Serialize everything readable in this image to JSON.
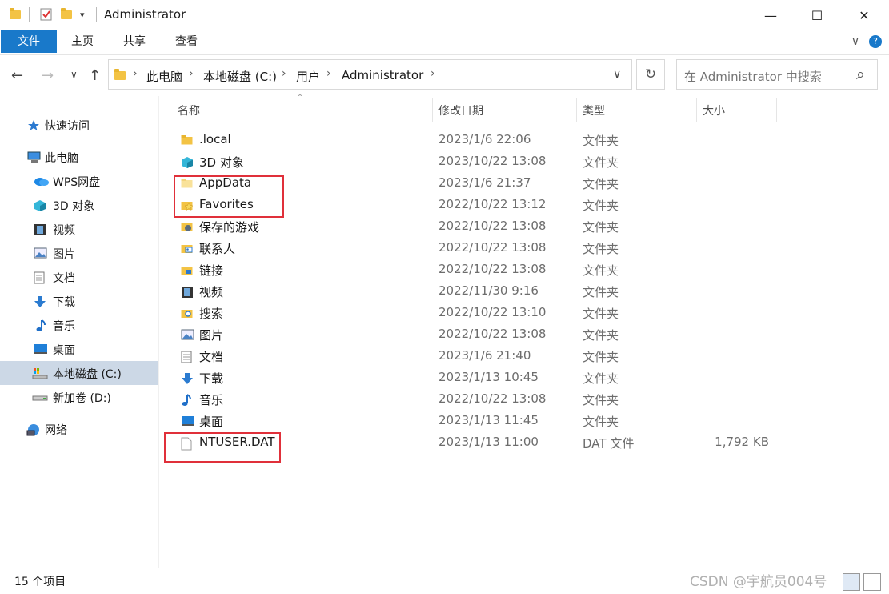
{
  "window": {
    "title": "Administrator",
    "minimize": "—",
    "maximize": "☐",
    "close": "✕"
  },
  "ribbon": {
    "tabs": [
      "文件",
      "主页",
      "共享",
      "查看"
    ],
    "expand_icon": "∨",
    "help_icon": "?"
  },
  "address": {
    "crumbs": [
      "此电脑",
      "本地磁盘 (C:)",
      "用户",
      "Administrator"
    ],
    "separator": "›",
    "dropdown": "∨",
    "refresh": "↻"
  },
  "search": {
    "placeholder": "在 Administrator 中搜索",
    "icon": "⌕"
  },
  "nav_glyphs": {
    "back": "←",
    "forward": "→",
    "recent": "∨",
    "up": "↑",
    "sort": "˄"
  },
  "sidebar": {
    "items": [
      {
        "label": "快速访问",
        "icon": "star-icon"
      },
      {
        "label": "此电脑",
        "icon": "computer-icon"
      },
      {
        "label": "WPS网盘",
        "icon": "cloud-icon"
      },
      {
        "label": "3D 对象",
        "icon": "cube-icon"
      },
      {
        "label": "视频",
        "icon": "video-icon"
      },
      {
        "label": "图片",
        "icon": "picture-icon"
      },
      {
        "label": "文档",
        "icon": "document-icon"
      },
      {
        "label": "下载",
        "icon": "download-icon"
      },
      {
        "label": "音乐",
        "icon": "music-icon"
      },
      {
        "label": "桌面",
        "icon": "desktop-icon"
      },
      {
        "label": "本地磁盘 (C:)",
        "icon": "drive-c-icon",
        "selected": true
      },
      {
        "label": "新加卷 (D:)",
        "icon": "drive-icon"
      },
      {
        "label": "网络",
        "icon": "network-icon"
      }
    ]
  },
  "columns": [
    "名称",
    "修改日期",
    "类型",
    "大小"
  ],
  "files": [
    {
      "name": ".local",
      "date": "2023/1/6 22:06",
      "type": "文件夹",
      "size": "",
      "icon": "folder-icon"
    },
    {
      "name": "3D 对象",
      "date": "2023/10/22 13:08",
      "type": "文件夹",
      "size": "",
      "icon": "cube-icon"
    },
    {
      "name": "AppData",
      "date": "2023/1/6 21:37",
      "type": "文件夹",
      "size": "",
      "icon": "folder-light-icon"
    },
    {
      "name": "Favorites",
      "date": "2022/10/22 13:12",
      "type": "文件夹",
      "size": "",
      "icon": "favorites-icon"
    },
    {
      "name": "保存的游戏",
      "date": "2022/10/22 13:08",
      "type": "文件夹",
      "size": "",
      "icon": "saved-games-icon"
    },
    {
      "name": "联系人",
      "date": "2022/10/22 13:08",
      "type": "文件夹",
      "size": "",
      "icon": "contacts-icon"
    },
    {
      "name": "链接",
      "date": "2022/10/22 13:08",
      "type": "文件夹",
      "size": "",
      "icon": "links-icon"
    },
    {
      "name": "视频",
      "date": "2022/11/30 9:16",
      "type": "文件夹",
      "size": "",
      "icon": "video-icon"
    },
    {
      "name": "搜索",
      "date": "2022/10/22 13:10",
      "type": "文件夹",
      "size": "",
      "icon": "search-folder-icon"
    },
    {
      "name": "图片",
      "date": "2022/10/22 13:08",
      "type": "文件夹",
      "size": "",
      "icon": "picture-icon"
    },
    {
      "name": "文档",
      "date": "2023/1/6 21:40",
      "type": "文件夹",
      "size": "",
      "icon": "document-icon"
    },
    {
      "name": "下载",
      "date": "2023/1/13 10:45",
      "type": "文件夹",
      "size": "",
      "icon": "download-icon"
    },
    {
      "name": "音乐",
      "date": "2022/10/22 13:08",
      "type": "文件夹",
      "size": "",
      "icon": "music-icon"
    },
    {
      "name": "桌面",
      "date": "2023/1/13 11:45",
      "type": "文件夹",
      "size": "",
      "icon": "desktop-icon"
    },
    {
      "name": "NTUSER.DAT",
      "date": "2023/1/13 11:00",
      "type": "DAT 文件",
      "size": "1,792 KB",
      "icon": "file-icon"
    }
  ],
  "status": {
    "count": "15 个项目"
  },
  "watermark": "CSDN @宇航员004号",
  "colors": {
    "accent": "#1979ca",
    "selected": "#ccd8e6",
    "highlight": "#e0303a"
  }
}
